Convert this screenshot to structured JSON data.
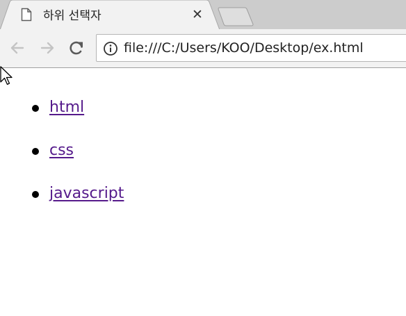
{
  "tab": {
    "title": "하위 선택자",
    "close_glyph": "✕"
  },
  "toolbar": {
    "url": "file:///C:/Users/KOO/Desktop/ex.html"
  },
  "page": {
    "links": [
      {
        "label": "html"
      },
      {
        "label": "css"
      },
      {
        "label": "javascript"
      }
    ]
  },
  "icons": {
    "page": "page-icon",
    "back": "back-arrow-icon",
    "forward": "forward-arrow-icon",
    "reload": "reload-icon",
    "info": "info-icon",
    "cursor": "mouse-cursor-icon"
  },
  "colors": {
    "link_visited": "#551a8b",
    "tabstrip": "#cccccc",
    "toolbar": "#f2f2f2"
  }
}
